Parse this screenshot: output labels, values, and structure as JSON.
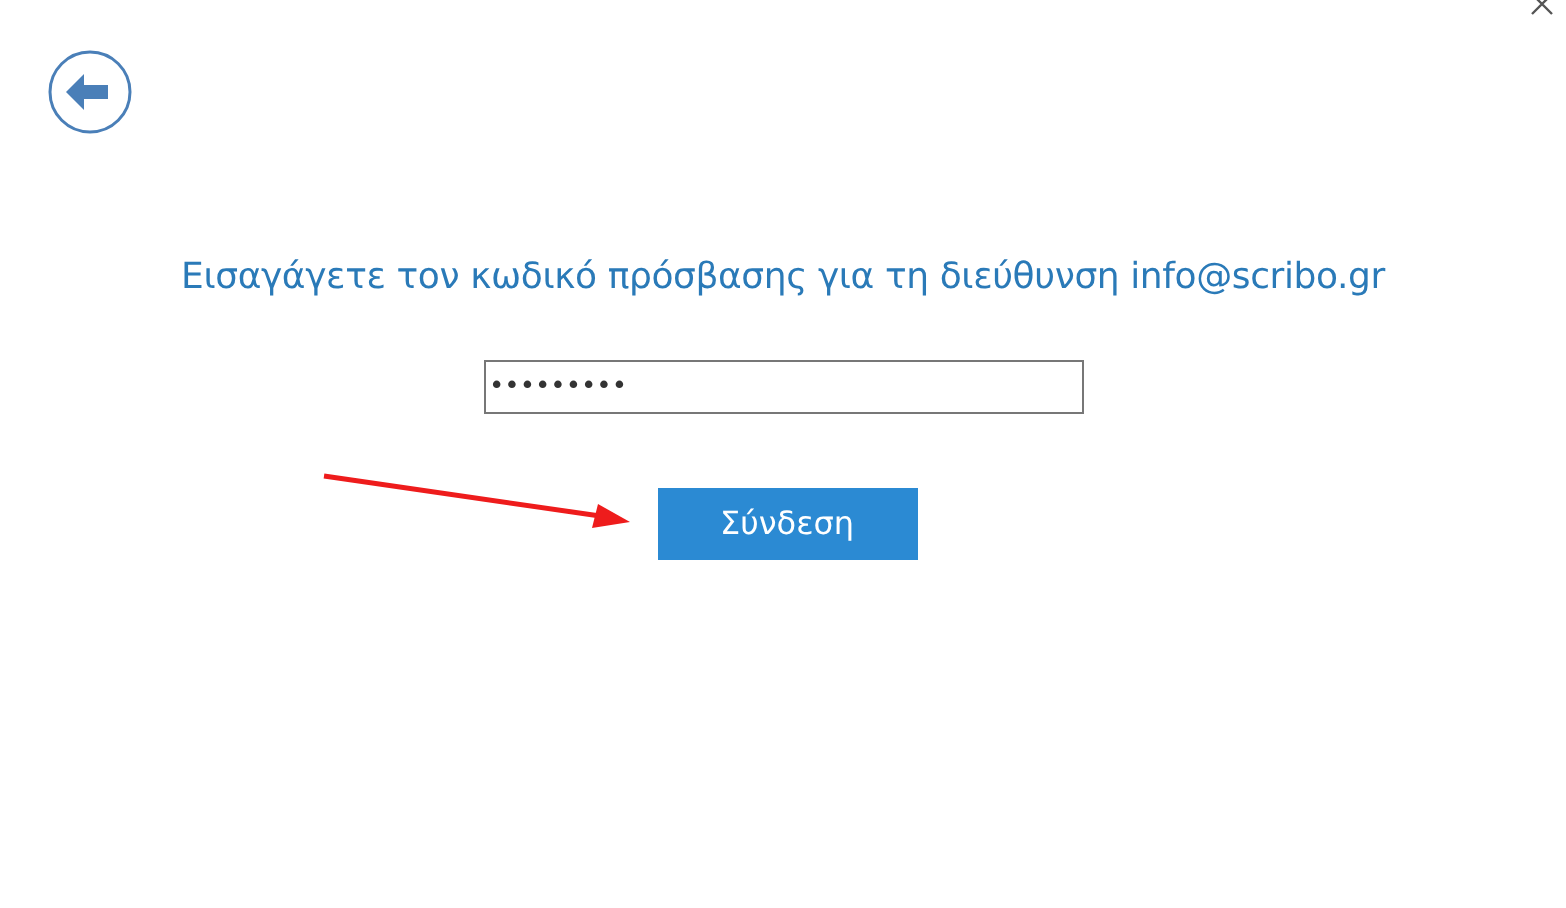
{
  "heading": "Εισαγάγετε τον κωδικό πρόσβασης για τη διεύθυνση info@scribo.gr",
  "password": {
    "value": "•••••••••"
  },
  "button": "Σύνδεση"
}
